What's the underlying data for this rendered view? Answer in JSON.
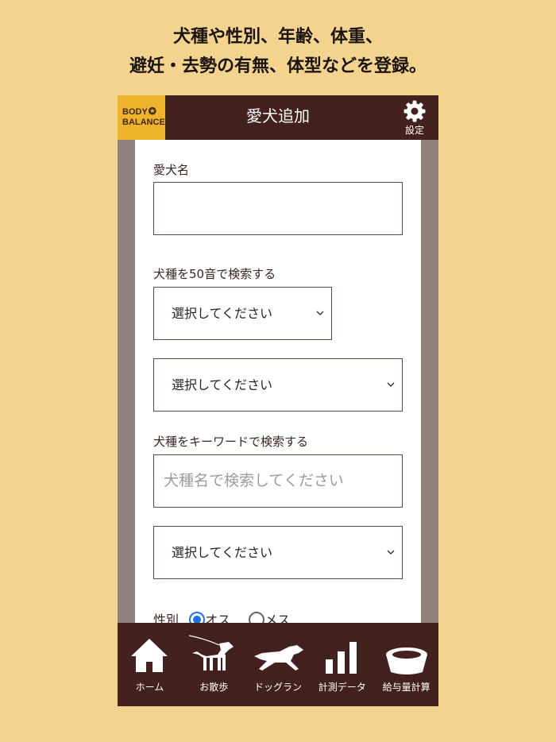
{
  "promo": {
    "line1": "犬種や性別、年齢、体重、",
    "line2": "避妊・去勢の有無、体型などを登録。"
  },
  "header": {
    "logo_line1": "BODY",
    "logo_line2": "BALANCE",
    "title": "愛犬追加",
    "settings_label": "設定"
  },
  "form": {
    "name_label": "愛犬名",
    "name_value": "",
    "kana_label": "犬種を50音で検索する",
    "kana_select": "選択してください",
    "breed_select_1": "選択してください",
    "keyword_label": "犬種をキーワードで検索する",
    "keyword_placeholder": "犬種名で検索してください",
    "breed_select_2": "選択してください",
    "gender_label": "性別",
    "gender_options": [
      "オス",
      "メス"
    ],
    "gender_selected": "オス"
  },
  "nav": {
    "items": [
      {
        "label": "ホーム",
        "icon": "house-icon"
      },
      {
        "label": "お散歩",
        "icon": "dog-walk-icon"
      },
      {
        "label": "ドッグラン",
        "icon": "running-dog-icon"
      },
      {
        "label": "計測データ",
        "icon": "bar-chart-icon"
      },
      {
        "label": "給与量計算",
        "icon": "food-bowl-icon"
      }
    ]
  },
  "colors": {
    "background": "#f2d48e",
    "header": "#42211f",
    "logo": "#f0b42c",
    "radio_accent": "#1a73e8"
  }
}
